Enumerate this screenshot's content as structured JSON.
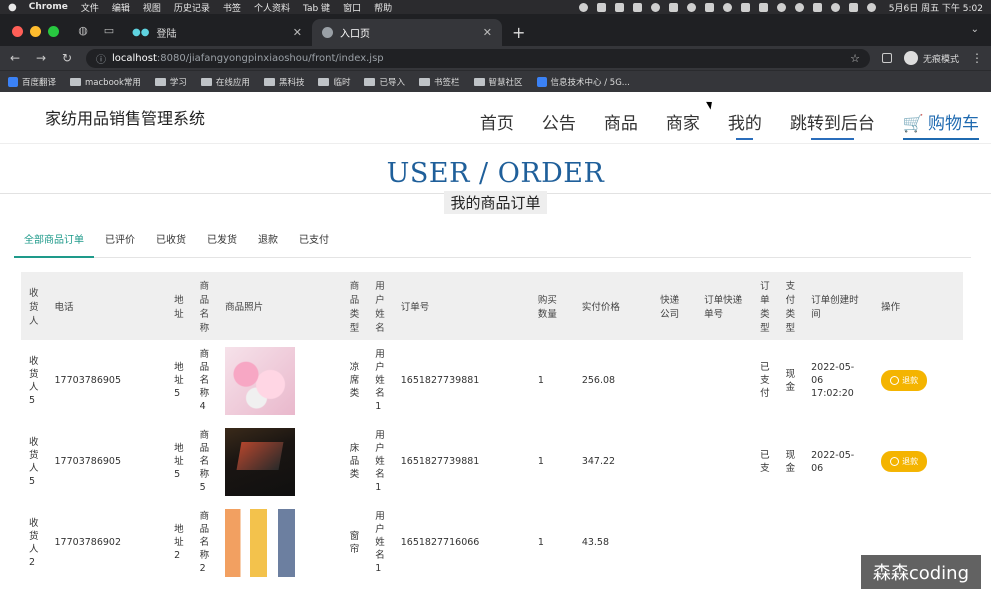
{
  "macbar": {
    "app": "Chrome",
    "menus": [
      "文件",
      "编辑",
      "视图",
      "历史记录",
      "书签",
      "个人资料",
      "Tab 键",
      "窗口",
      "帮助"
    ],
    "clock": "5月6日 周五 下午 5:02"
  },
  "browser": {
    "tabs": [
      {
        "title": "登陆"
      },
      {
        "title": "入口页"
      }
    ],
    "url_host": "localhost",
    "url_rest": ":8080/jiafangyongpinxiaoshou/front/index.jsp",
    "incognito_label": "无痕模式",
    "bookmarks": [
      "百度翻译",
      "macbook常用",
      "学习",
      "在线应用",
      "黑科技",
      "临时",
      "已导入",
      "书签栏",
      "智慧社区",
      "信息技术中心 / 5G..."
    ]
  },
  "site": {
    "title": "家纺用品销售管理系统",
    "nav": [
      "首页",
      "公告",
      "商品",
      "商家",
      "我的",
      "跳转到后台",
      "购物车"
    ]
  },
  "heading": {
    "en": "USER / ORDER",
    "cn": "我的商品订单"
  },
  "filters": [
    "全部商品订单",
    "已评价",
    "已收货",
    "已发货",
    "退款",
    "已支付"
  ],
  "table": {
    "headers": [
      "收货人",
      "电话",
      "地址",
      "商品名称",
      "商品照片",
      "商品类型",
      "用户姓名",
      "订单号",
      "购买数量",
      "实付价格",
      "快递公司",
      "订单快递单号",
      "订单类型",
      "支付类型",
      "订单创建时间",
      "操作"
    ],
    "rows": [
      {
        "receiver": "收货人5",
        "phone": "17703786905",
        "address": "地址5",
        "name": "商品名称4",
        "photo": "flowers",
        "type": "凉席类",
        "user": "用户姓名1",
        "order_no": "1651827739881",
        "qty": "1",
        "price": "256.08",
        "express": "",
        "express_no": "",
        "order_type": "已支付",
        "pay_type": "现金",
        "created": "2022-05-06 17:02:20",
        "action": "退款"
      },
      {
        "receiver": "收货人5",
        "phone": "17703786905",
        "address": "地址5",
        "name": "商品名称5",
        "photo": "laptop",
        "type": "床品类",
        "user": "用户姓名1",
        "order_no": "1651827739881",
        "qty": "1",
        "price": "347.22",
        "express": "",
        "express_no": "",
        "order_type": "已支",
        "pay_type": "现金",
        "created": "2022-05-06",
        "action": "退款"
      },
      {
        "receiver": "收货人2",
        "phone": "17703786902",
        "address": "地址2",
        "name": "商品名称2",
        "photo": "phones",
        "type": "窗帘",
        "user": "用户姓名1",
        "order_no": "1651827716066",
        "qty": "1",
        "price": "43.58",
        "express": "",
        "express_no": "",
        "order_type": "",
        "pay_type": "",
        "created": "",
        "action": ""
      }
    ]
  },
  "watermark": "森森coding"
}
